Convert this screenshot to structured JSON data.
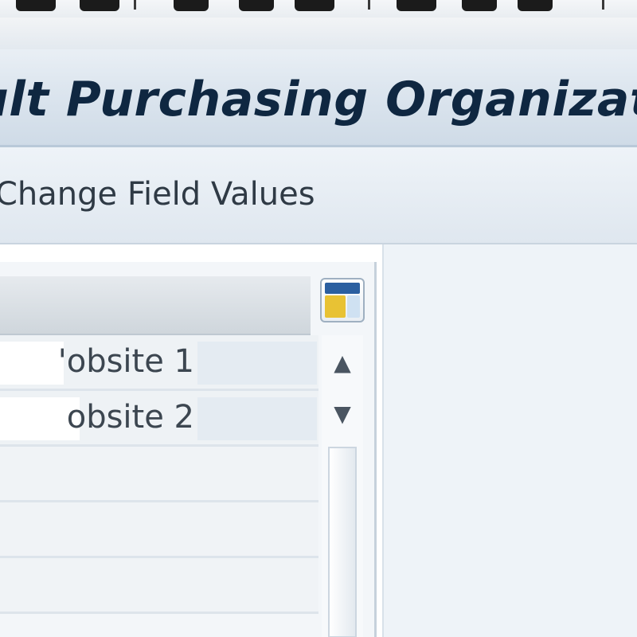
{
  "window": {
    "title": "ult Purchasing Organization"
  },
  "toolbar": {
    "icons": [
      "toolbar-icon",
      "toolbar-icon",
      "toolbar-icon",
      "toolbar-icon",
      "toolbar-icon",
      "toolbar-icon"
    ]
  },
  "app_toolbar": {
    "change_field_values_label": "Change Field Values"
  },
  "table": {
    "config_icon": "table-settings-icon",
    "rows": [
      {
        "value": "'obsite 1"
      },
      {
        "value": "obsite 2"
      },
      {
        "value": ""
      },
      {
        "value": ""
      },
      {
        "value": ""
      }
    ],
    "scroll_up_glyph": "▲",
    "scroll_down_glyph": "▼"
  },
  "colors": {
    "title_text": "#0f2741",
    "title_bar": "#dde6ef",
    "content_bg": "#eef3f8"
  }
}
